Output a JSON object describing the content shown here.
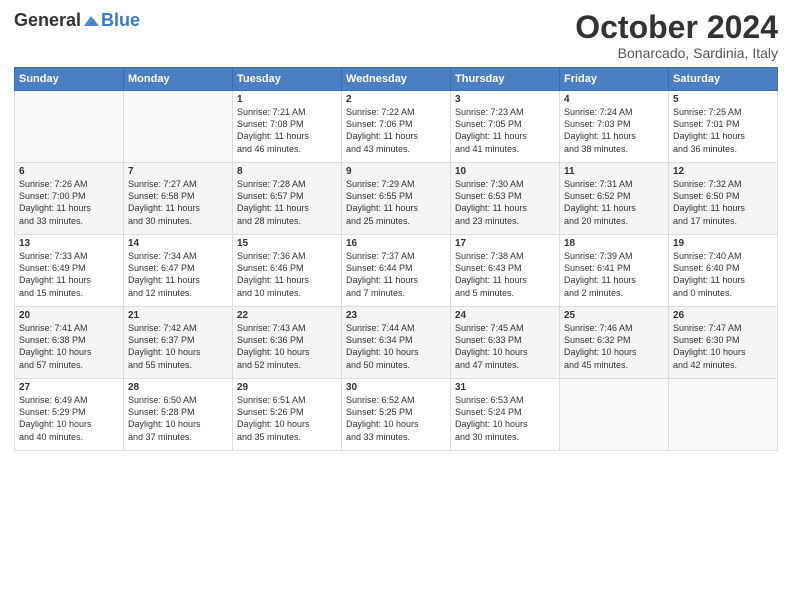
{
  "logo": {
    "general": "General",
    "blue": "Blue"
  },
  "header": {
    "month": "October 2024",
    "location": "Bonarcado, Sardinia, Italy"
  },
  "weekdays": [
    "Sunday",
    "Monday",
    "Tuesday",
    "Wednesday",
    "Thursday",
    "Friday",
    "Saturday"
  ],
  "weeks": [
    [
      {
        "day": "",
        "sunrise": "",
        "sunset": "",
        "daylight": ""
      },
      {
        "day": "",
        "sunrise": "",
        "sunset": "",
        "daylight": ""
      },
      {
        "day": "1",
        "sunrise": "Sunrise: 7:21 AM",
        "sunset": "Sunset: 7:08 PM",
        "daylight": "Daylight: 11 hours and 46 minutes."
      },
      {
        "day": "2",
        "sunrise": "Sunrise: 7:22 AM",
        "sunset": "Sunset: 7:06 PM",
        "daylight": "Daylight: 11 hours and 43 minutes."
      },
      {
        "day": "3",
        "sunrise": "Sunrise: 7:23 AM",
        "sunset": "Sunset: 7:05 PM",
        "daylight": "Daylight: 11 hours and 41 minutes."
      },
      {
        "day": "4",
        "sunrise": "Sunrise: 7:24 AM",
        "sunset": "Sunset: 7:03 PM",
        "daylight": "Daylight: 11 hours and 38 minutes."
      },
      {
        "day": "5",
        "sunrise": "Sunrise: 7:25 AM",
        "sunset": "Sunset: 7:01 PM",
        "daylight": "Daylight: 11 hours and 36 minutes."
      }
    ],
    [
      {
        "day": "6",
        "sunrise": "Sunrise: 7:26 AM",
        "sunset": "Sunset: 7:00 PM",
        "daylight": "Daylight: 11 hours and 33 minutes."
      },
      {
        "day": "7",
        "sunrise": "Sunrise: 7:27 AM",
        "sunset": "Sunset: 6:58 PM",
        "daylight": "Daylight: 11 hours and 30 minutes."
      },
      {
        "day": "8",
        "sunrise": "Sunrise: 7:28 AM",
        "sunset": "Sunset: 6:57 PM",
        "daylight": "Daylight: 11 hours and 28 minutes."
      },
      {
        "day": "9",
        "sunrise": "Sunrise: 7:29 AM",
        "sunset": "Sunset: 6:55 PM",
        "daylight": "Daylight: 11 hours and 25 minutes."
      },
      {
        "day": "10",
        "sunrise": "Sunrise: 7:30 AM",
        "sunset": "Sunset: 6:53 PM",
        "daylight": "Daylight: 11 hours and 23 minutes."
      },
      {
        "day": "11",
        "sunrise": "Sunrise: 7:31 AM",
        "sunset": "Sunset: 6:52 PM",
        "daylight": "Daylight: 11 hours and 20 minutes."
      },
      {
        "day": "12",
        "sunrise": "Sunrise: 7:32 AM",
        "sunset": "Sunset: 6:50 PM",
        "daylight": "Daylight: 11 hours and 17 minutes."
      }
    ],
    [
      {
        "day": "13",
        "sunrise": "Sunrise: 7:33 AM",
        "sunset": "Sunset: 6:49 PM",
        "daylight": "Daylight: 11 hours and 15 minutes."
      },
      {
        "day": "14",
        "sunrise": "Sunrise: 7:34 AM",
        "sunset": "Sunset: 6:47 PM",
        "daylight": "Daylight: 11 hours and 12 minutes."
      },
      {
        "day": "15",
        "sunrise": "Sunrise: 7:36 AM",
        "sunset": "Sunset: 6:46 PM",
        "daylight": "Daylight: 11 hours and 10 minutes."
      },
      {
        "day": "16",
        "sunrise": "Sunrise: 7:37 AM",
        "sunset": "Sunset: 6:44 PM",
        "daylight": "Daylight: 11 hours and 7 minutes."
      },
      {
        "day": "17",
        "sunrise": "Sunrise: 7:38 AM",
        "sunset": "Sunset: 6:43 PM",
        "daylight": "Daylight: 11 hours and 5 minutes."
      },
      {
        "day": "18",
        "sunrise": "Sunrise: 7:39 AM",
        "sunset": "Sunset: 6:41 PM",
        "daylight": "Daylight: 11 hours and 2 minutes."
      },
      {
        "day": "19",
        "sunrise": "Sunrise: 7:40 AM",
        "sunset": "Sunset: 6:40 PM",
        "daylight": "Daylight: 11 hours and 0 minutes."
      }
    ],
    [
      {
        "day": "20",
        "sunrise": "Sunrise: 7:41 AM",
        "sunset": "Sunset: 6:38 PM",
        "daylight": "Daylight: 10 hours and 57 minutes."
      },
      {
        "day": "21",
        "sunrise": "Sunrise: 7:42 AM",
        "sunset": "Sunset: 6:37 PM",
        "daylight": "Daylight: 10 hours and 55 minutes."
      },
      {
        "day": "22",
        "sunrise": "Sunrise: 7:43 AM",
        "sunset": "Sunset: 6:36 PM",
        "daylight": "Daylight: 10 hours and 52 minutes."
      },
      {
        "day": "23",
        "sunrise": "Sunrise: 7:44 AM",
        "sunset": "Sunset: 6:34 PM",
        "daylight": "Daylight: 10 hours and 50 minutes."
      },
      {
        "day": "24",
        "sunrise": "Sunrise: 7:45 AM",
        "sunset": "Sunset: 6:33 PM",
        "daylight": "Daylight: 10 hours and 47 minutes."
      },
      {
        "day": "25",
        "sunrise": "Sunrise: 7:46 AM",
        "sunset": "Sunset: 6:32 PM",
        "daylight": "Daylight: 10 hours and 45 minutes."
      },
      {
        "day": "26",
        "sunrise": "Sunrise: 7:47 AM",
        "sunset": "Sunset: 6:30 PM",
        "daylight": "Daylight: 10 hours and 42 minutes."
      }
    ],
    [
      {
        "day": "27",
        "sunrise": "Sunrise: 6:49 AM",
        "sunset": "Sunset: 5:29 PM",
        "daylight": "Daylight: 10 hours and 40 minutes."
      },
      {
        "day": "28",
        "sunrise": "Sunrise: 6:50 AM",
        "sunset": "Sunset: 5:28 PM",
        "daylight": "Daylight: 10 hours and 37 minutes."
      },
      {
        "day": "29",
        "sunrise": "Sunrise: 6:51 AM",
        "sunset": "Sunset: 5:26 PM",
        "daylight": "Daylight: 10 hours and 35 minutes."
      },
      {
        "day": "30",
        "sunrise": "Sunrise: 6:52 AM",
        "sunset": "Sunset: 5:25 PM",
        "daylight": "Daylight: 10 hours and 33 minutes."
      },
      {
        "day": "31",
        "sunrise": "Sunrise: 6:53 AM",
        "sunset": "Sunset: 5:24 PM",
        "daylight": "Daylight: 10 hours and 30 minutes."
      },
      {
        "day": "",
        "sunrise": "",
        "sunset": "",
        "daylight": ""
      },
      {
        "day": "",
        "sunrise": "",
        "sunset": "",
        "daylight": ""
      }
    ]
  ]
}
